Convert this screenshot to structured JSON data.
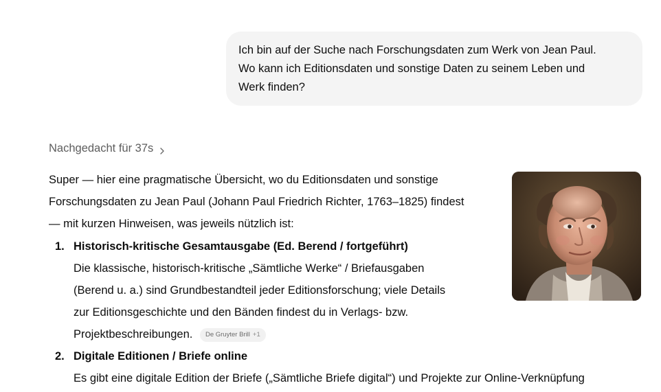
{
  "user_message": {
    "line1": "Ich bin auf der Suche nach Forschungsdaten zum Werk von Jean Paul.",
    "line2": "Wo kann ich Editionsdaten und sonstige Daten zu seinem Leben und",
    "line3": "Werk finden?"
  },
  "thinking": {
    "label": "Nachgedacht für 37s",
    "icon": "chevron-right-icon"
  },
  "intro": {
    "line1": "Super — hier eine pragmatische Übersicht, wo du Editionsdaten und sonstige",
    "line2": "Forschungsdaten zu Jean Paul (Johann Paul Friedrich Richter, 1763–1825) findest",
    "line3": "— mit kurzen Hinweisen, was jeweils nützlich ist:"
  },
  "portrait": {
    "icon": "portrait-image"
  },
  "list": [
    {
      "number": "1.",
      "title": "Historisch-kritische Gesamtausgabe (Ed. Berend / fortgeführt)",
      "line1": "Die klassische, historisch-kritische „Sämtliche Werke“ / Briefausgaben",
      "line2": "(Berend u. a.) sind Grundbestandteil jeder Editionsforschung; viele Details",
      "line3": "zur Editionsgeschichte und den Bänden findest du in Verlags- bzw.",
      "line4": "Projektbeschreibungen.",
      "source": {
        "label": "De Gruyter Brill",
        "extra": "+1"
      }
    },
    {
      "number": "2.",
      "title": "Digitale Editionen / Briefe online",
      "line1": "Es gibt eine digitale Edition der Briefe („Sämtliche Briefe digital“) und Projekte zur Online-Verknüpfung"
    }
  ]
}
